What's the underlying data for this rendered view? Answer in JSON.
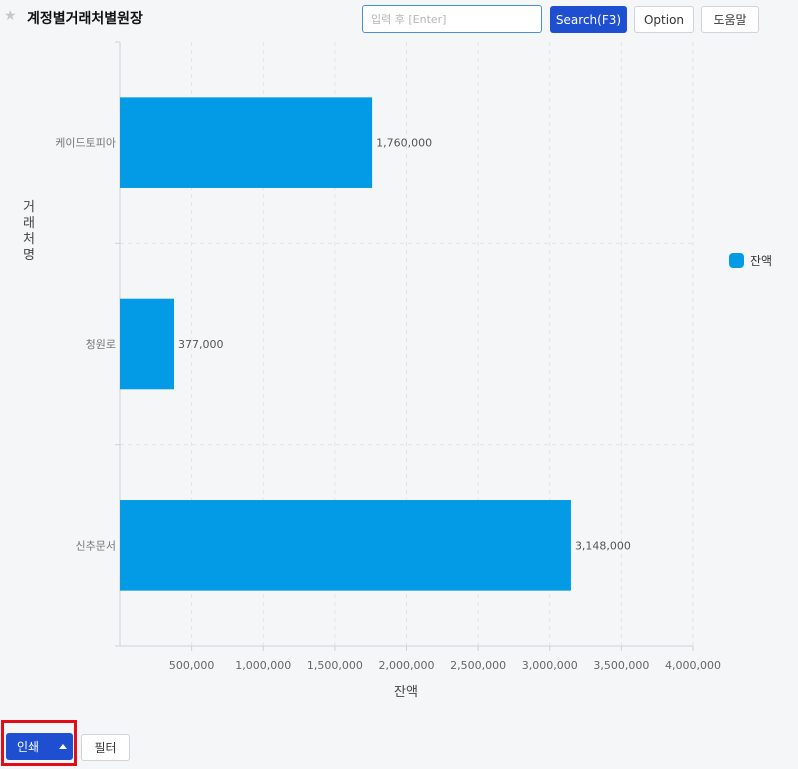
{
  "header": {
    "star_icon": "★",
    "title": "계정별거래처별원장",
    "search_placeholder": "입력 후 [Enter]",
    "search_label": "Search(F3)",
    "option_label": "Option",
    "help_label": "도움말"
  },
  "chart_data": {
    "type": "bar",
    "orientation": "horizontal",
    "categories": [
      "케이드토피아",
      "청원로",
      "신추문서"
    ],
    "values": [
      1760000,
      377000,
      3148000
    ],
    "value_labels": [
      "1,760,000",
      "377,000",
      "3,148,000"
    ],
    "xlabel": "잔액",
    "ylabel": "거래처명",
    "xlim": [
      0,
      4000000
    ],
    "xticks": [
      500000,
      1000000,
      1500000,
      2000000,
      2500000,
      3000000,
      3500000,
      4000000
    ],
    "xtick_labels": [
      "500,000",
      "1,000,000",
      "1,500,000",
      "2,000,000",
      "2,500,000",
      "3,000,000",
      "3,500,000",
      "4,000,000"
    ],
    "series": [
      {
        "name": "잔액",
        "color": "#039be5"
      }
    ],
    "legend_position": "right",
    "grid": true
  },
  "footer": {
    "print_label": "인쇄",
    "filter_label": "필터"
  }
}
